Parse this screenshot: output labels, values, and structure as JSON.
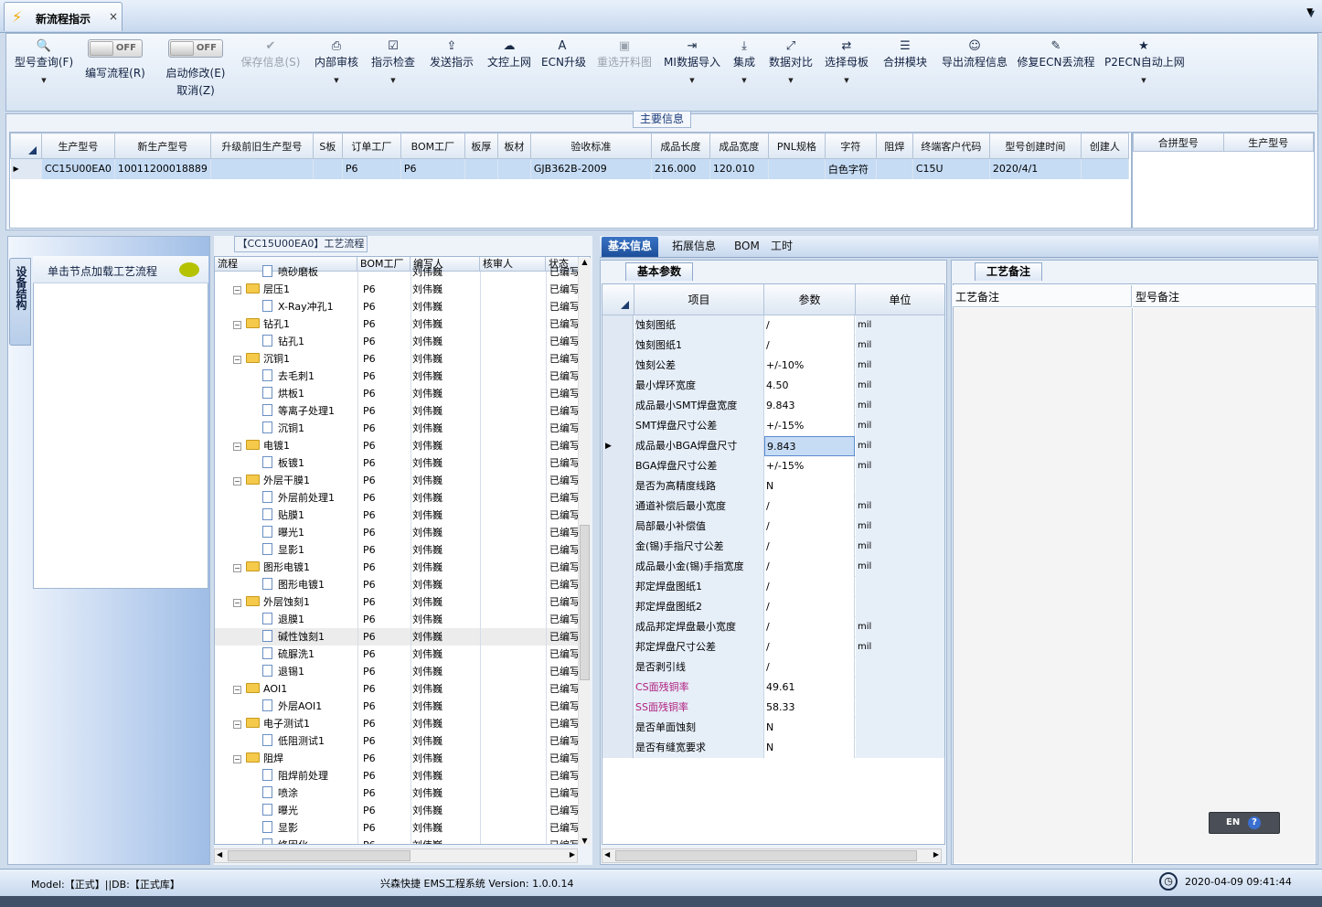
{
  "window": {
    "tab_title": "新流程指示",
    "close": "×",
    "menu_arrow": "▼"
  },
  "toolbar": [
    {
      "icon": "search-icon",
      "glyph": "🔍",
      "label": "型号查询(F)",
      "arrow": true
    },
    {
      "toggle": true,
      "state": "OFF",
      "label": "编写流程(R)"
    },
    {
      "toggle": true,
      "state": "OFF",
      "label": "启动修改(E)",
      "label2": "取消(Z)"
    },
    {
      "icon": "check-icon",
      "glyph": "✔",
      "label": "保存信息(S)",
      "disabled": true
    },
    {
      "icon": "printer-icon",
      "glyph": "⎙",
      "label": "内部审核",
      "arrow": true
    },
    {
      "icon": "checkbox-icon",
      "glyph": "☑",
      "label": "指示检查",
      "arrow": true
    },
    {
      "icon": "upload-icon",
      "glyph": "⇪",
      "label": "发送指示"
    },
    {
      "icon": "cloud-upload-icon",
      "glyph": "☁",
      "label": "文控上网"
    },
    {
      "icon": "font-icon",
      "glyph": "A",
      "label": "ECN升级"
    },
    {
      "icon": "image-icon",
      "glyph": "▣",
      "label": "重选开料图",
      "disabled": true
    },
    {
      "icon": "import-icon",
      "glyph": "⇥",
      "label": "MI数据导入",
      "arrow": true
    },
    {
      "icon": "download-icon",
      "glyph": "⤓",
      "label": "集成",
      "arrow": true
    },
    {
      "icon": "compare-icon",
      "glyph": "⤢",
      "label": "数据对比",
      "arrow": true
    },
    {
      "icon": "shuffle-icon",
      "glyph": "⇄",
      "label": "选择母板",
      "arrow": true
    },
    {
      "icon": "list-icon",
      "glyph": "☰",
      "label": "合拼模块"
    },
    {
      "icon": "smile-icon",
      "glyph": "☺",
      "label": "导出流程信息"
    },
    {
      "icon": "wrench-icon",
      "glyph": "✎",
      "label": "修复ECN丢流程"
    },
    {
      "icon": "star-icon",
      "glyph": "★",
      "label": "P2ECN自动上网",
      "arrow": true
    }
  ],
  "main_info": {
    "caption": "主要信息",
    "columns": [
      "生产型号",
      "新生产型号",
      "升级前旧生产型号",
      "S板",
      "订单工厂",
      "BOM工厂",
      "板厚",
      "板材",
      "验收标准",
      "成品长度",
      "成品宽度",
      "PNL规格",
      "字符",
      "阻焊",
      "终端客户代码",
      "型号创建时间",
      "创建人"
    ],
    "row": [
      "CC15U00EA0",
      "10011200018889",
      "",
      "",
      "P6",
      "P6",
      "",
      "",
      "GJB362B-2009",
      "216.000",
      "120.010",
      "",
      "白色字符",
      "",
      "C15U",
      "2020/4/1",
      ""
    ],
    "merge_columns": [
      "合拼型号",
      "生产型号"
    ]
  },
  "side": {
    "vtab": "设备结构",
    "hint": "单击节点加载工艺流程"
  },
  "tree": {
    "caption": "【CC15U00EA0】工艺流程",
    "columns": [
      "流程",
      "BOM工厂",
      "编写人",
      "核审人",
      "状态"
    ],
    "rows": [
      {
        "level": 1,
        "name": "喷砂磨板",
        "bom": "",
        "writer": "刘伟巍",
        "status": "已编写"
      },
      {
        "level": 0,
        "name": "层压1",
        "bom": "P6",
        "writer": "刘伟巍",
        "status": "已编写"
      },
      {
        "level": 1,
        "name": "X-Ray冲孔1",
        "bom": "P6",
        "writer": "刘伟巍",
        "status": "已编写"
      },
      {
        "level": 0,
        "name": "钻孔1",
        "bom": "P6",
        "writer": "刘伟巍",
        "status": "已编写"
      },
      {
        "level": 1,
        "name": "钻孔1",
        "bom": "P6",
        "writer": "刘伟巍",
        "status": "已编写"
      },
      {
        "level": 0,
        "name": "沉铜1",
        "bom": "P6",
        "writer": "刘伟巍",
        "status": "已编写"
      },
      {
        "level": 1,
        "name": "去毛刺1",
        "bom": "P6",
        "writer": "刘伟巍",
        "status": "已编写"
      },
      {
        "level": 1,
        "name": "烘板1",
        "bom": "P6",
        "writer": "刘伟巍",
        "status": "已编写"
      },
      {
        "level": 1,
        "name": "等离子处理1",
        "bom": "P6",
        "writer": "刘伟巍",
        "status": "已编写"
      },
      {
        "level": 1,
        "name": "沉铜1",
        "bom": "P6",
        "writer": "刘伟巍",
        "status": "已编写"
      },
      {
        "level": 0,
        "name": "电镀1",
        "bom": "P6",
        "writer": "刘伟巍",
        "status": "已编写"
      },
      {
        "level": 1,
        "name": "板镀1",
        "bom": "P6",
        "writer": "刘伟巍",
        "status": "已编写"
      },
      {
        "level": 0,
        "name": "外层干膜1",
        "bom": "P6",
        "writer": "刘伟巍",
        "status": "已编写"
      },
      {
        "level": 1,
        "name": "外层前处理1",
        "bom": "P6",
        "writer": "刘伟巍",
        "status": "已编写"
      },
      {
        "level": 1,
        "name": "贴膜1",
        "bom": "P6",
        "writer": "刘伟巍",
        "status": "已编写"
      },
      {
        "level": 1,
        "name": "曝光1",
        "bom": "P6",
        "writer": "刘伟巍",
        "status": "已编写"
      },
      {
        "level": 1,
        "name": "显影1",
        "bom": "P6",
        "writer": "刘伟巍",
        "status": "已编写"
      },
      {
        "level": 0,
        "name": "图形电镀1",
        "bom": "P6",
        "writer": "刘伟巍",
        "status": "已编写"
      },
      {
        "level": 1,
        "name": "图形电镀1",
        "bom": "P6",
        "writer": "刘伟巍",
        "status": "已编写"
      },
      {
        "level": 0,
        "name": "外层蚀刻1",
        "bom": "P6",
        "writer": "刘伟巍",
        "status": "已编写"
      },
      {
        "level": 1,
        "name": "退膜1",
        "bom": "P6",
        "writer": "刘伟巍",
        "status": "已编写"
      },
      {
        "level": 1,
        "name": "碱性蚀刻1",
        "bom": "P6",
        "writer": "刘伟巍",
        "status": "已编写",
        "hl": true
      },
      {
        "level": 1,
        "name": "硫脲洗1",
        "bom": "P6",
        "writer": "刘伟巍",
        "status": "已编写"
      },
      {
        "level": 1,
        "name": "退锡1",
        "bom": "P6",
        "writer": "刘伟巍",
        "status": "已编写"
      },
      {
        "level": 0,
        "name": "AOI1",
        "bom": "P6",
        "writer": "刘伟巍",
        "status": "已编写"
      },
      {
        "level": 1,
        "name": "外层AOI1",
        "bom": "P6",
        "writer": "刘伟巍",
        "status": "已编写"
      },
      {
        "level": 0,
        "name": "电子测试1",
        "bom": "P6",
        "writer": "刘伟巍",
        "status": "已编写"
      },
      {
        "level": 1,
        "name": "低阻测试1",
        "bom": "P6",
        "writer": "刘伟巍",
        "status": "已编写"
      },
      {
        "level": 0,
        "name": "阻焊",
        "bom": "P6",
        "writer": "刘伟巍",
        "status": "已编写"
      },
      {
        "level": 1,
        "name": "阻焊前处理",
        "bom": "P6",
        "writer": "刘伟巍",
        "status": "已编写"
      },
      {
        "level": 1,
        "name": "喷涂",
        "bom": "P6",
        "writer": "刘伟巍",
        "status": "已编写"
      },
      {
        "level": 1,
        "name": "曝光",
        "bom": "P6",
        "writer": "刘伟巍",
        "status": "已编写"
      },
      {
        "level": 1,
        "name": "显影",
        "bom": "P6",
        "writer": "刘伟巍",
        "status": "已编写"
      },
      {
        "level": 1,
        "name": "终固化",
        "bom": "P6",
        "writer": "刘伟巍",
        "status": "已编写"
      }
    ]
  },
  "right_tabs": [
    "基本信息",
    "拓展信息",
    "BOM",
    "工时"
  ],
  "params": {
    "tab": "基本参数",
    "columns": [
      "项目",
      "参数",
      "单位"
    ],
    "rows": [
      {
        "item": "蚀刻图纸",
        "value": "/",
        "unit": "mil"
      },
      {
        "item": "蚀刻图纸1",
        "value": "/",
        "unit": "mil"
      },
      {
        "item": "蚀刻公差",
        "value": "+/-10%",
        "unit": "mil"
      },
      {
        "item": "最小焊环宽度",
        "value": "4.50",
        "unit": "mil"
      },
      {
        "item": "成品最小SMT焊盘宽度",
        "value": "9.843",
        "unit": "mil"
      },
      {
        "item": "SMT焊盘尺寸公差",
        "value": "+/-15%",
        "unit": "mil"
      },
      {
        "item": "成品最小BGA焊盘尺寸",
        "value": "9.843",
        "unit": "mil",
        "current": true
      },
      {
        "item": "BGA焊盘尺寸公差",
        "value": "+/-15%",
        "unit": "mil"
      },
      {
        "item": "是否为高精度线路",
        "value": "N",
        "unit": ""
      },
      {
        "item": "通道补偿后最小宽度",
        "value": "/",
        "unit": "mil"
      },
      {
        "item": "局部最小补偿值",
        "value": "/",
        "unit": "mil"
      },
      {
        "item": "金(锡)手指尺寸公差",
        "value": "/",
        "unit": "mil"
      },
      {
        "item": "成品最小金(锡)手指宽度",
        "value": "/",
        "unit": "mil"
      },
      {
        "item": "邦定焊盘图纸1",
        "value": "/",
        "unit": ""
      },
      {
        "item": "邦定焊盘图纸2",
        "value": "/",
        "unit": ""
      },
      {
        "item": "成品邦定焊盘最小宽度",
        "value": "/",
        "unit": "mil"
      },
      {
        "item": "邦定焊盘尺寸公差",
        "value": "/",
        "unit": "mil"
      },
      {
        "item": "是否剥引线",
        "value": "/",
        "unit": ""
      },
      {
        "item": "CS面残铜率",
        "value": "49.61",
        "unit": "",
        "colored": true
      },
      {
        "item": "SS面残铜率",
        "value": "58.33",
        "unit": "",
        "colored": true
      },
      {
        "item": "是否单面蚀刻",
        "value": "N",
        "unit": ""
      },
      {
        "item": "是否有缝宽要求",
        "value": "N",
        "unit": ""
      }
    ]
  },
  "remark": {
    "tab": "工艺备注",
    "col1": "工艺备注",
    "col2": "型号备注"
  },
  "lang": {
    "code": "EN",
    "help": "?"
  },
  "status": {
    "left": "Model:【正式】||DB:【正式库】",
    "center": "兴森快捷 EMS工程系统 Version: 1.0.0.14",
    "datetime": "2020-04-09 09:41:44"
  },
  "colors": {
    "accent": "#1d4f9a",
    "selection": "#c6dcf5",
    "highlight_text": "#b0207e"
  }
}
